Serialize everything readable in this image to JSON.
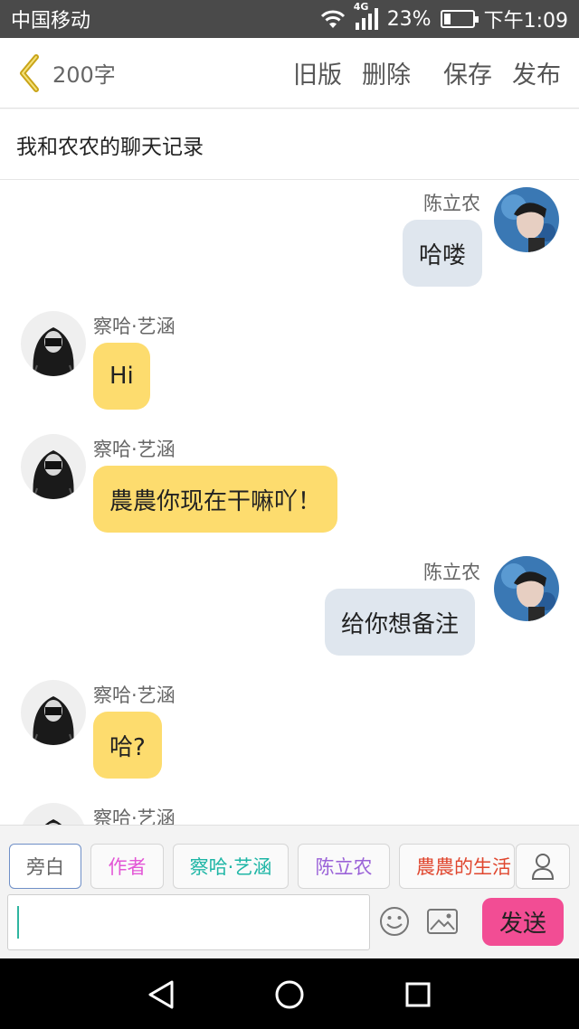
{
  "status_bar": {
    "carrier": "中国移动",
    "network": "4G",
    "battery": "23%",
    "battery_level": 0.23,
    "time": "下午1:09"
  },
  "header": {
    "word_count": "200字",
    "actions": [
      "旧版",
      "删除",
      "保存",
      "发布"
    ]
  },
  "title": "我和农农的聊天记录",
  "messages": [
    {
      "side": "right",
      "sender": "陈立农",
      "text": "哈喽"
    },
    {
      "side": "left",
      "sender": "察哈·艺涵",
      "text": "Hi"
    },
    {
      "side": "left",
      "sender": "察哈·艺涵",
      "text": "農農你现在干嘛吖！"
    },
    {
      "side": "right",
      "sender": "陈立农",
      "text": "给你想备注"
    },
    {
      "side": "left",
      "sender": "察哈·艺涵",
      "text": "哈?"
    },
    {
      "side": "left",
      "sender": "察哈·艺涵",
      "text": ""
    }
  ],
  "roles": [
    {
      "label": "旁白",
      "color": "#666666"
    },
    {
      "label": "作者",
      "color": "#e356d6"
    },
    {
      "label": "察哈·艺涵",
      "color": "#1fb6a6"
    },
    {
      "label": "陈立农",
      "color": "#9b63d8"
    },
    {
      "label": "農農的生活",
      "color": "#e0472f"
    }
  ],
  "input": {
    "value": ""
  },
  "send_label": "发送",
  "icons": {
    "back": "chevron-left-icon",
    "emoji": "smiley-icon",
    "image": "image-icon",
    "person": "person-icon"
  },
  "colors": {
    "accent_yellow": "#fddc6e",
    "bubble_gray": "#dfe6ee",
    "send_pink": "#f24d94",
    "back_arrow": "#c9a418"
  }
}
